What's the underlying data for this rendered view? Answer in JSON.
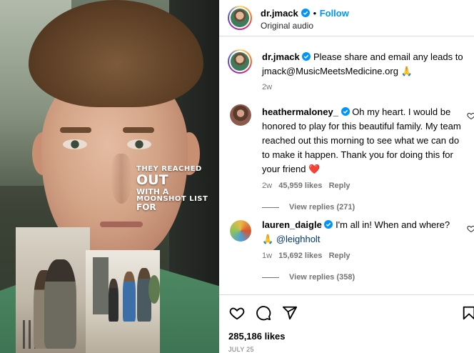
{
  "media": {
    "overlay_text": {
      "line1": "THEY REACHED",
      "line2": "OUT",
      "line3": "WITH A",
      "line4": "MOONSHOT LIST",
      "line5": "FOR"
    }
  },
  "header": {
    "username": "dr.jmack",
    "separator": "•",
    "follow_label": "Follow",
    "audio_label": "Original audio"
  },
  "caption": {
    "username": "dr.jmack",
    "text_part1": "Please share and email any leads to",
    "text_part2": "jmack@MusicMeetsMedicine.org",
    "emoji": "🙏",
    "time": "2w"
  },
  "comments": [
    {
      "username": "heathermaloney_",
      "text": "Oh my heart. I would be honored to play for this beautiful family. My team reached out this morning to see what we can do to make it happen. Thank you for doing this for your friend",
      "emoji": "❤️",
      "time": "2w",
      "likes": "45,959 likes",
      "reply_label": "Reply",
      "view_replies": "View replies (271)"
    },
    {
      "username": "lauren_daigle",
      "text": "I'm all in! When and where?",
      "emoji": "🙏",
      "mention": "@leighholt",
      "time": "1w",
      "likes": "15,692 likes",
      "reply_label": "Reply",
      "view_replies": "View replies (358)"
    }
  ],
  "post": {
    "likes": "285,186 likes",
    "date": "JULY 25"
  },
  "icons": {
    "verified": "verified-badge-icon",
    "more": "more-options-icon",
    "like": "heart-icon",
    "comment": "comment-icon",
    "share": "share-icon",
    "save": "bookmark-icon"
  },
  "colors": {
    "accent": "#0095f6",
    "secondary_text": "#737373",
    "heart_red": "#ed4956"
  }
}
